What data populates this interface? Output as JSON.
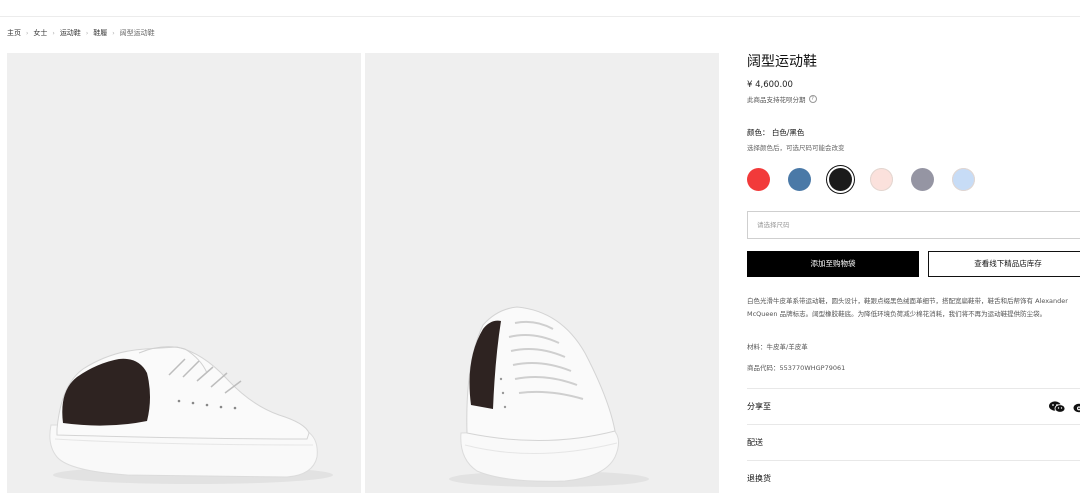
{
  "breadcrumb": {
    "items": [
      "主页",
      "女士",
      "运动鞋",
      "鞋履",
      "阔型运动鞋"
    ],
    "separator": "›"
  },
  "product": {
    "title": "阔型运动鞋",
    "price": "¥ 4,600.00",
    "installment_note": "此商品支持花呗分期",
    "color_label": "颜色： 白色/黑色",
    "color_note": "选择颜色后，可选尺码可能会改变",
    "swatches": [
      {
        "name": "red",
        "color": "#f23a3a"
      },
      {
        "name": "steel-blue",
        "color": "#4a79a7"
      },
      {
        "name": "black",
        "color": "#1b1b1b",
        "selected": true
      },
      {
        "name": "blush-pink",
        "color": "#fbe1dc"
      },
      {
        "name": "grey-lilac",
        "color": "#9595a3"
      },
      {
        "name": "light-blue",
        "color": "#c7dcf6"
      }
    ],
    "size_placeholder": "请选择尺码",
    "add_to_bag": "添加至购物袋",
    "check_store": "查看线下精品店库存",
    "description": "白色光滑牛皮革系带运动鞋，圆头设计，鞋跟点缀黑色绒面革细节，搭配宽扁鞋带，鞋舌和后帮饰有 Alexander McQueen 品牌标志。阔型橡胶鞋底。为降低环境负荷减少棉花消耗，我们将不再为运动鞋提供防尘袋。",
    "material": "材料：牛皮革/羊皮革",
    "product_code": "商品代码：553770WHGP79061"
  },
  "accordion": {
    "share": "分享至",
    "shipping": "配送",
    "returns": "退换货"
  },
  "icons": {
    "wechat": "wechat-icon",
    "weibo": "weibo-icon",
    "help": "help-icon"
  },
  "colors": {
    "primary": "#000000",
    "page_bg": "#ffffff",
    "photo_bg": "#efefef"
  }
}
